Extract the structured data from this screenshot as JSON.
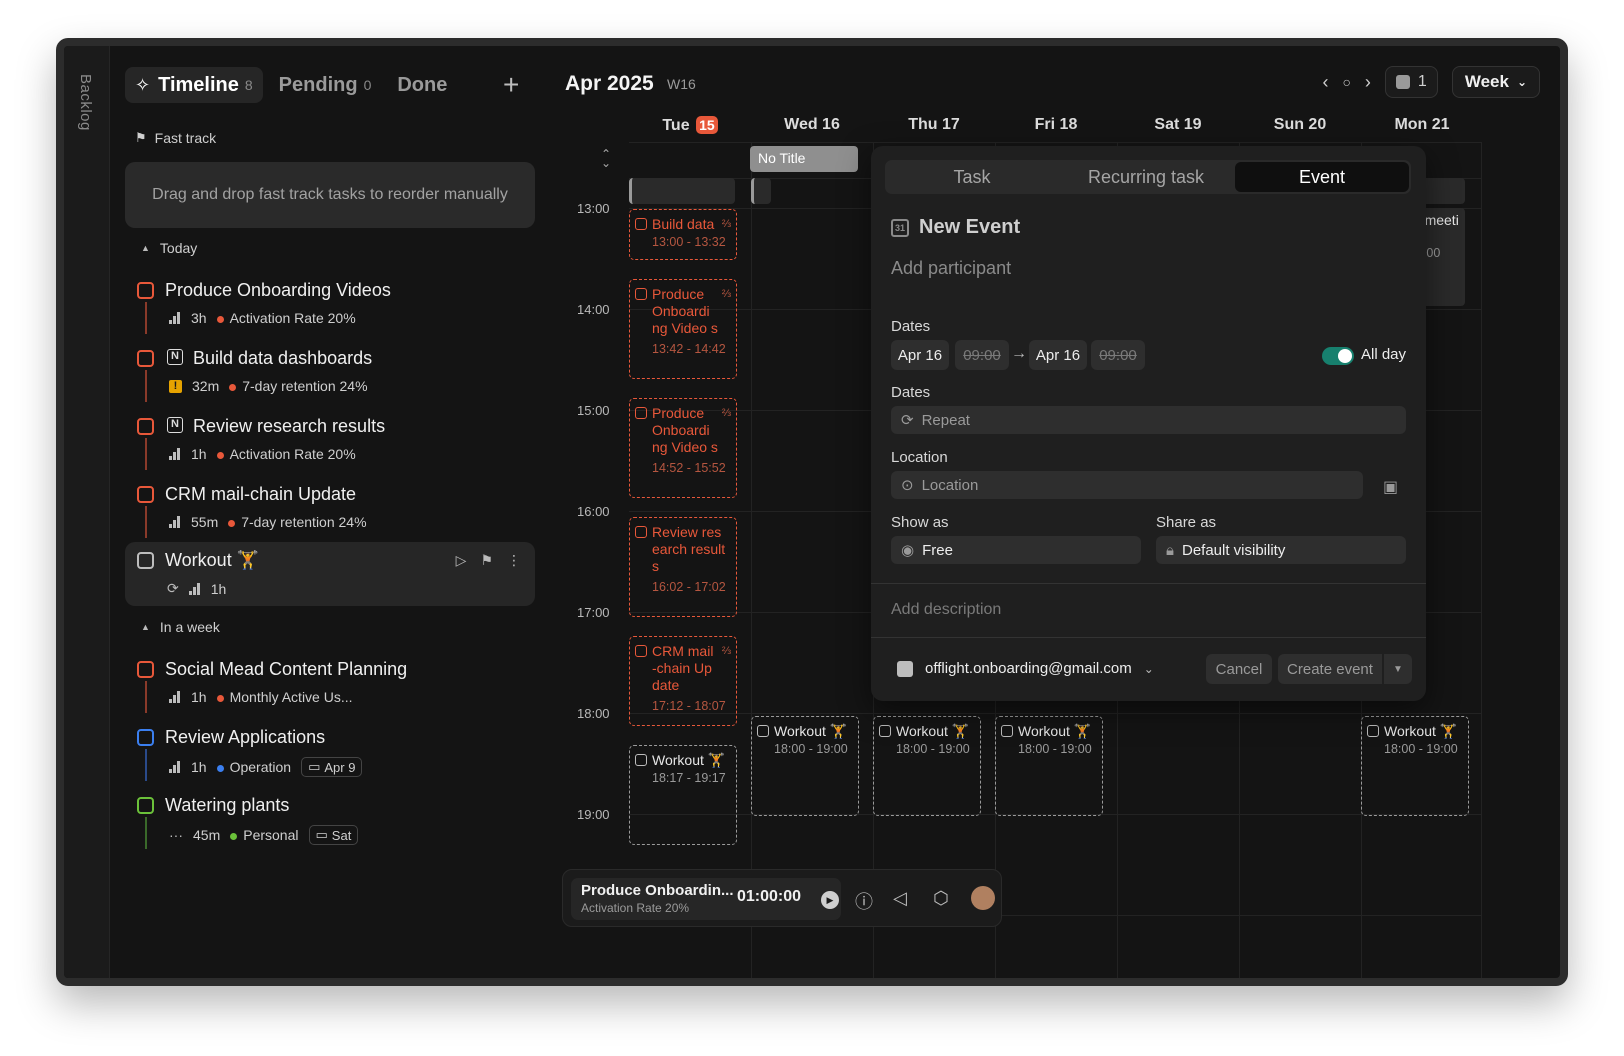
{
  "backlog": {
    "label": "Backlog"
  },
  "tabs": {
    "timeline": {
      "label": "Timeline",
      "count": "8"
    },
    "pending": {
      "label": "Pending",
      "count": "0"
    },
    "done": {
      "label": "Done"
    },
    "add": "+"
  },
  "fast_track": {
    "label": "Fast track",
    "placeholder": "Drag and drop fast track tasks to reorder manually"
  },
  "sections": {
    "today": "Today",
    "week": "In a week"
  },
  "tasks": [
    {
      "title": "Produce Onboarding Videos",
      "duration": "3h",
      "goal": "Activation Rate 20%"
    },
    {
      "title": "Build data dashboards",
      "duration": "32m",
      "goal": "7-day retention 24%",
      "source": "N"
    },
    {
      "title": "Review research results",
      "duration": "1h",
      "goal": "Activation Rate 20%",
      "source": "N"
    },
    {
      "title": "CRM mail-chain Update",
      "duration": "55m",
      "goal": "7-day retention 24%"
    },
    {
      "title": "Workout",
      "emoji": "🏋",
      "duration": "1h",
      "repeat": "⟳"
    },
    {
      "title": "Social Mead Content Planning",
      "duration": "1h",
      "goal": "Monthly Active Us..."
    },
    {
      "title": "Review Applications",
      "duration": "1h",
      "goal": "Operation",
      "date": "Apr 9"
    },
    {
      "title": "Watering plants",
      "duration": "45m",
      "goal": "Personal",
      "date": "Sat",
      "priority": "···"
    }
  ],
  "calendar": {
    "title": "Apr 2025",
    "week": "W16",
    "calendar_count": "1",
    "view": "Week",
    "days": [
      {
        "name": "Tue",
        "num": "15",
        "today": true
      },
      {
        "name": "Wed 16"
      },
      {
        "name": "Thu 17"
      },
      {
        "name": "Fri 18"
      },
      {
        "name": "Sat 19"
      },
      {
        "name": "Sun 20"
      },
      {
        "name": "Mon 21"
      }
    ],
    "times": [
      "13:00",
      "14:00",
      "15:00",
      "16:00",
      "17:00",
      "18:00",
      "19:00"
    ],
    "events": [
      {
        "title": "Build data",
        "time": "13:00 - 13:32",
        "frac": "⅔"
      },
      {
        "title": "Produce Onboardi ng Video s",
        "time": "13:42 - 14:42",
        "frac": "⅔"
      },
      {
        "title": "Produce Onboardi ng Video s",
        "time": "14:52 - 15:52",
        "frac": "⅔"
      },
      {
        "title": "Review res earch result s",
        "time": "16:02 - 17:02"
      },
      {
        "title": "CRM mail -chain Up date",
        "time": "17:12 - 18:07",
        "frac": "⅔"
      },
      {
        "title": "Workout 🏋",
        "time": "18:17 - 19:17"
      },
      {
        "title": "Workout 🏋",
        "time": "18:00 - 19:00"
      },
      {
        "title": "Workout 🏋",
        "time": "18:00 - 19:00"
      },
      {
        "title": "Workout 🏋",
        "time": "18:00 - 19:00"
      },
      {
        "title": "Workout 🏋",
        "time": "18:00 - 19:00"
      }
    ],
    "mon_partial": {
      "title": "et meeti",
      "time": "14:00"
    },
    "no_title": "No Title"
  },
  "modal": {
    "tabs": [
      "Task",
      "Recurring task",
      "Event"
    ],
    "title": "New Event",
    "participant_placeholder": "Add participant",
    "dates_label": "Dates",
    "start_date": "Apr 16",
    "start_time": "09:00",
    "end_date": "Apr 16",
    "end_time": "09:00",
    "all_day": "All day",
    "repeat_label": "Dates",
    "repeat": "Repeat",
    "location_label": "Location",
    "location_placeholder": "Location",
    "show_as_label": "Show as",
    "show_as": "Free",
    "share_as_label": "Share as",
    "share_as": "Default visibility",
    "description_placeholder": "Add description",
    "account": "offlight.onboarding@gmail.com",
    "cancel": "Cancel",
    "create": "Create event"
  },
  "player": {
    "title": "Produce Onboardin...",
    "subtitle": "Activation Rate 20%",
    "time": "01:00:00"
  },
  "colors": {
    "accent": "#e8583a",
    "toggle": "#17806e",
    "blue": "#3b7ff0",
    "green": "#6bc13a"
  }
}
